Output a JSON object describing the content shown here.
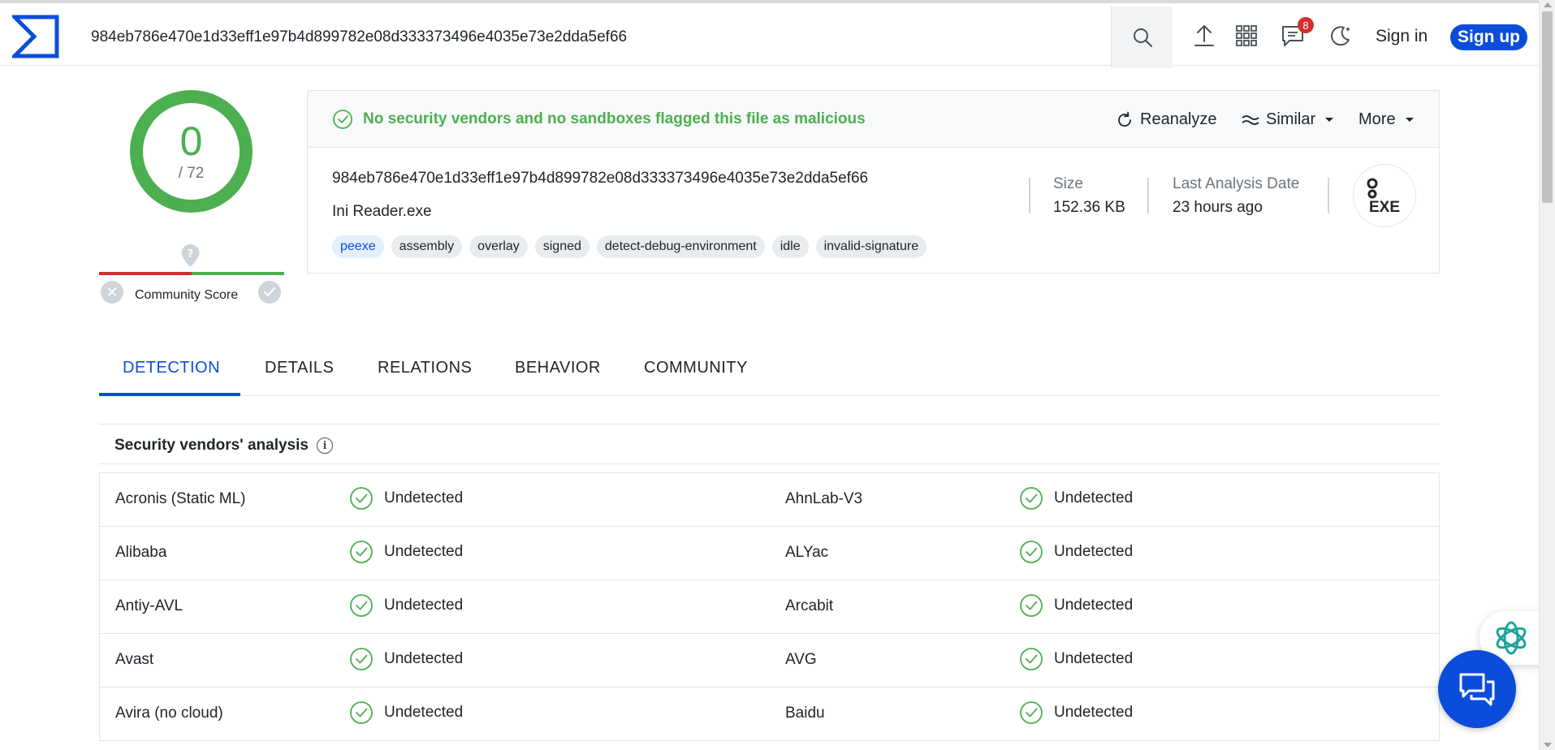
{
  "search": {
    "value": "984eb786e470e1d33eff1e97b4d899782e08d333373496e4035e73e2dda5ef66"
  },
  "header": {
    "notifications_count": "8",
    "signin_label": "Sign in",
    "signup_label": "Sign up"
  },
  "score": {
    "detections": "0",
    "total": "/ 72",
    "community_label": "Community Score"
  },
  "file": {
    "verdict": "No security vendors and no sandboxes flagged this file as malicious",
    "actions": {
      "reanalyze": "Reanalyze",
      "similar": "Similar",
      "more": "More"
    },
    "hash": "984eb786e470e1d33eff1e97b4d899782e08d333373496e4035e73e2dda5ef66",
    "name": "Ini Reader.exe",
    "tags": [
      "peexe",
      "assembly",
      "overlay",
      "signed",
      "detect-debug-environment",
      "idle",
      "invalid-signature"
    ],
    "size_label": "Size",
    "size_value": "152.36 KB",
    "date_label": "Last Analysis Date",
    "date_value": "23 hours ago",
    "type_label": "EXE"
  },
  "tabs": [
    "DETECTION",
    "DETAILS",
    "RELATIONS",
    "BEHAVIOR",
    "COMMUNITY"
  ],
  "vendors": {
    "title": "Security vendors' analysis",
    "rows": [
      {
        "left": {
          "name": "Acronis (Static ML)",
          "result": "Undetected"
        },
        "right": {
          "name": "AhnLab-V3",
          "result": "Undetected"
        }
      },
      {
        "left": {
          "name": "Alibaba",
          "result": "Undetected"
        },
        "right": {
          "name": "ALYac",
          "result": "Undetected"
        }
      },
      {
        "left": {
          "name": "Antiy-AVL",
          "result": "Undetected"
        },
        "right": {
          "name": "Arcabit",
          "result": "Undetected"
        }
      },
      {
        "left": {
          "name": "Avast",
          "result": "Undetected"
        },
        "right": {
          "name": "AVG",
          "result": "Undetected"
        }
      },
      {
        "left": {
          "name": "Avira (no cloud)",
          "result": "Undetected"
        },
        "right": {
          "name": "Baidu",
          "result": "Undetected"
        }
      }
    ]
  },
  "colors": {
    "accent": "#0b4dda",
    "clean": "#4caf50",
    "malicious": "#d32f2f",
    "badge": "#d32f2f"
  }
}
